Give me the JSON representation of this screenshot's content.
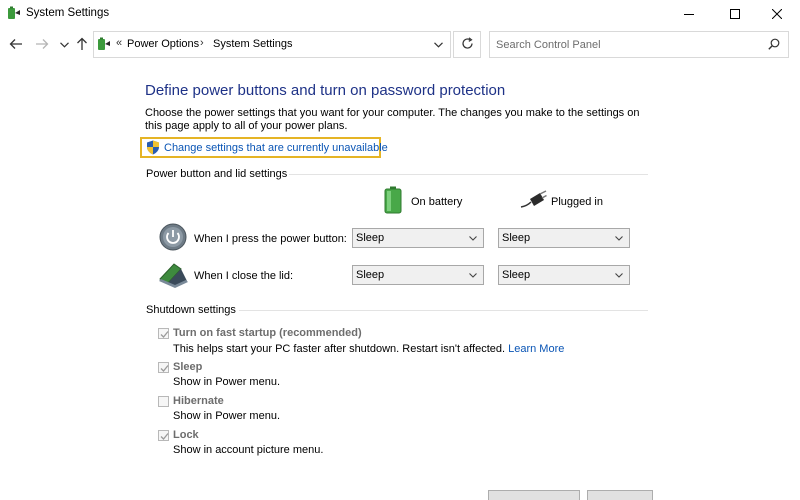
{
  "window": {
    "title": "System Settings"
  },
  "address": {
    "crumb_prefix": "«",
    "crumbs": [
      "Power Options",
      "System Settings"
    ],
    "separator": "›"
  },
  "search": {
    "placeholder": "Search Control Panel"
  },
  "page": {
    "heading": "Define power buttons and turn on password protection",
    "description": "Choose the power settings that you want for your computer. The changes you make to the settings on this page apply to all of your power plans.",
    "change_link": "Change settings that are currently unavailable"
  },
  "power_section": {
    "title": "Power button and lid settings",
    "col_battery": "On battery",
    "col_plugged": "Plugged in",
    "rows": [
      {
        "label": "When I press the power button:",
        "battery": "Sleep",
        "plugged": "Sleep"
      },
      {
        "label": "When I close the lid:",
        "battery": "Sleep",
        "plugged": "Sleep"
      }
    ]
  },
  "shutdown_section": {
    "title": "Shutdown settings",
    "options": [
      {
        "title": "Turn on fast startup (recommended)",
        "desc": "This helps start your PC faster after shutdown. Restart isn't affected.",
        "link": "Learn More",
        "checked": true
      },
      {
        "title": "Sleep",
        "desc": "Show in Power menu.",
        "checked": true
      },
      {
        "title": "Hibernate",
        "desc": "Show in Power menu.",
        "checked": false
      },
      {
        "title": "Lock",
        "desc": "Show in account picture menu.",
        "checked": true
      }
    ]
  },
  "colors": {
    "heading": "#1e3287",
    "link": "#0a55b5",
    "highlight_border": "#e5b425",
    "disabled_text": "#6d6d6d"
  },
  "icons": {
    "app": "power-options-icon",
    "back": "arrow-left-icon",
    "forward": "arrow-right-icon",
    "recent": "chevron-down-icon",
    "up": "arrow-up-icon",
    "refresh": "refresh-icon",
    "search": "search-icon",
    "shield": "uac-shield-icon",
    "power_button": "power-button-icon",
    "lid": "laptop-lid-icon",
    "battery": "battery-icon",
    "plug": "plug-icon"
  }
}
